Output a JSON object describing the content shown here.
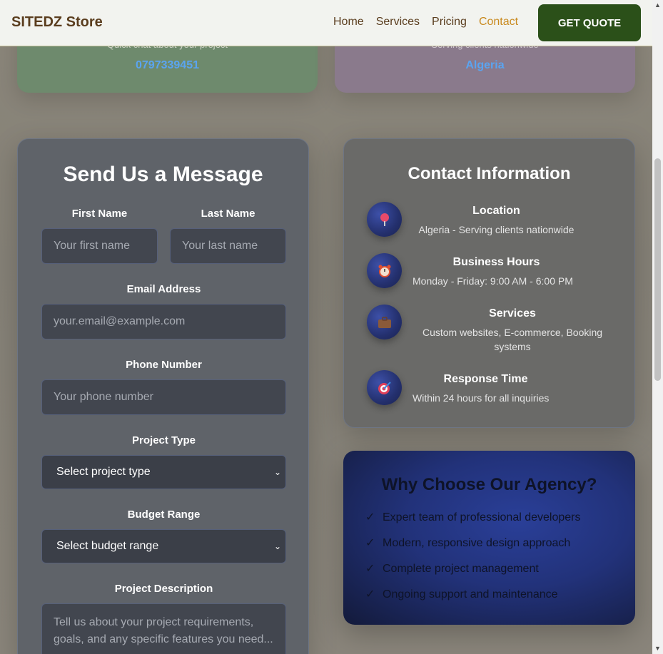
{
  "nav": {
    "brand": "SITEDZ Store",
    "links": [
      "Home",
      "Services",
      "Pricing",
      "Contact"
    ],
    "active": "Contact",
    "cta": "GET QUOTE"
  },
  "top_cards": [
    {
      "subtitle": "Quick chat about your project",
      "value": "0797339451"
    },
    {
      "subtitle": "Serving clients nationwide",
      "value": "Algeria"
    }
  ],
  "form": {
    "title": "Send Us a Message",
    "first_name_label": "First Name",
    "first_name_placeholder": "Your first name",
    "last_name_label": "Last Name",
    "last_name_placeholder": "Your last name",
    "email_label": "Email Address",
    "email_placeholder": "your.email@example.com",
    "phone_label": "Phone Number",
    "phone_placeholder": "Your phone number",
    "project_type_label": "Project Type",
    "project_type_value": "Select project type",
    "budget_label": "Budget Range",
    "budget_value": "Select budget range",
    "description_label": "Project Description",
    "description_placeholder": "Tell us about your project requirements, goals, and any specific features you need..."
  },
  "info": {
    "title": "Contact Information",
    "items": [
      {
        "icon": "pin-icon",
        "head": "Location",
        "text": "Algeria - Serving clients nationwide"
      },
      {
        "icon": "alarm-clock-icon",
        "head": "Business Hours",
        "text": "Monday - Friday: 9:00 AM - 6:00 PM"
      },
      {
        "icon": "briefcase-icon",
        "head": "Services",
        "text": "Custom websites, E-commerce, Booking systems"
      },
      {
        "icon": "target-icon",
        "head": "Response Time",
        "text": "Within 24 hours for all inquiries"
      }
    ]
  },
  "why": {
    "title": "Why Choose Our Agency?",
    "check": "✓",
    "items": [
      "Expert team of professional developers",
      "Modern, responsive design approach",
      "Complete project management",
      "Ongoing support and maintenance"
    ]
  },
  "colors": {
    "brand": "#5a3d1e",
    "accent": "#c98a1f",
    "cta_bg": "#2b5019",
    "link_blue": "#5aa4f0"
  }
}
